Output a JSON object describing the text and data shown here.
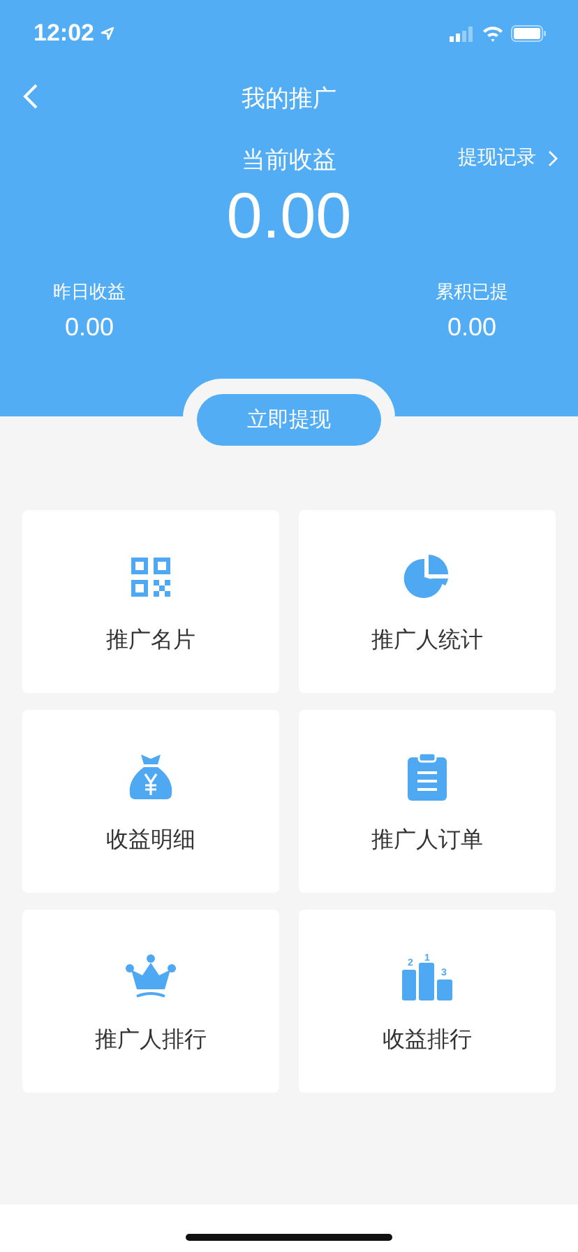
{
  "status_bar": {
    "time": "12:02"
  },
  "nav": {
    "title": "我的推广"
  },
  "earnings": {
    "label": "当前收益",
    "amount": "0.00",
    "link": "提现记录"
  },
  "stats": [
    {
      "label": "昨日收益",
      "value": "0.00"
    },
    {
      "label": "累积已提",
      "value": "0.00"
    }
  ],
  "withdraw_button": "立即提现",
  "tiles": [
    {
      "kind": "qr",
      "label": "推广名片"
    },
    {
      "kind": "pie",
      "label": "推广人统计"
    },
    {
      "kind": "moneybag",
      "label": "收益明细"
    },
    {
      "kind": "clipboard",
      "label": "推广人订单"
    },
    {
      "kind": "crown",
      "label": "推广人排行"
    },
    {
      "kind": "podium",
      "label": "收益排行"
    }
  ],
  "podium_icon_labels": [
    "2",
    "1",
    "3"
  ]
}
